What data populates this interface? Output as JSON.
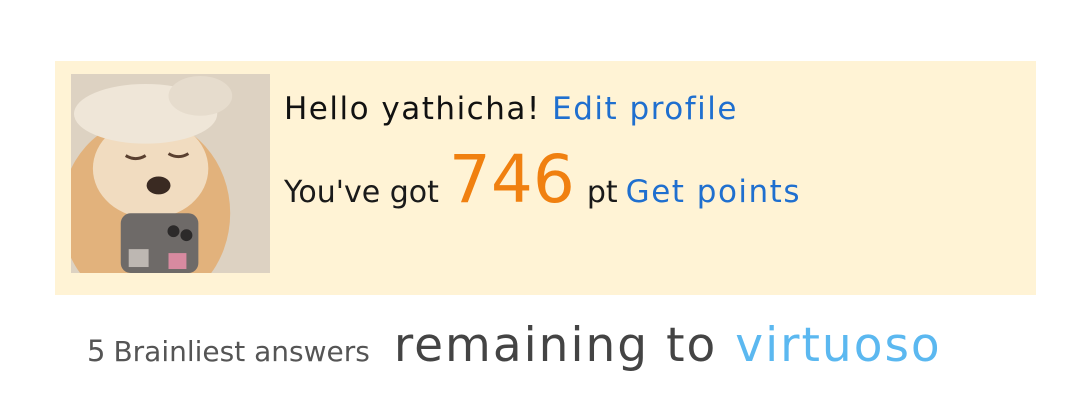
{
  "profile": {
    "greeting": "Hello yathicha!",
    "edit_profile_label": "Edit profile",
    "points_prefix": "You've got",
    "points_value": "746",
    "points_unit": "pt",
    "get_points_label": "Get points",
    "avatar_description": "profile-photo"
  },
  "rank": {
    "count": "5",
    "label": "Brainliest answers",
    "remaining": "remaining to",
    "next_rank": "virtuoso"
  },
  "colors": {
    "card_background": "#fff3d5",
    "link": "#1f6fcf",
    "points": "#f08010",
    "next_rank": "#5bb8f0"
  }
}
